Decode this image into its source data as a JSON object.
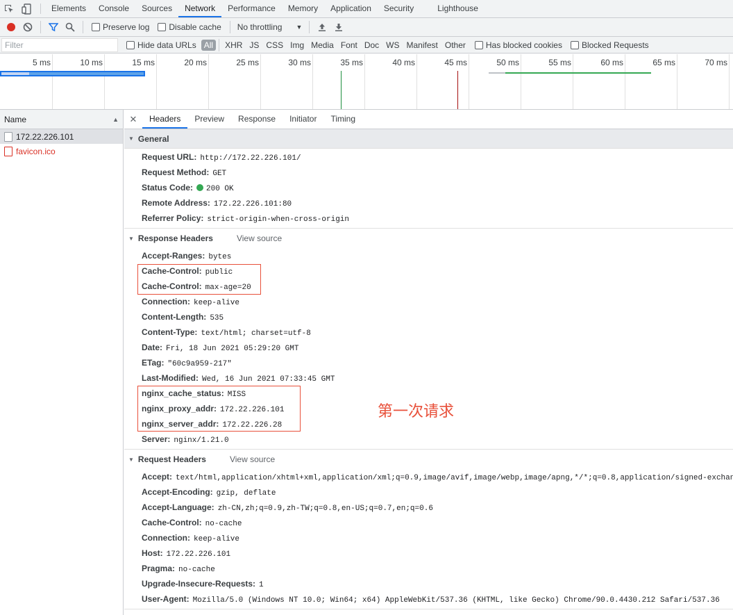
{
  "tabs": [
    {
      "label": "Elements"
    },
    {
      "label": "Console"
    },
    {
      "label": "Sources"
    },
    {
      "label": "Network"
    },
    {
      "label": "Performance"
    },
    {
      "label": "Memory"
    },
    {
      "label": "Application"
    },
    {
      "label": "Security"
    },
    {
      "label": "Lighthouse"
    }
  ],
  "toolbar": {
    "preserve_log": "Preserve log",
    "disable_cache": "Disable cache",
    "throttling": "No throttling"
  },
  "filterbar": {
    "filter_placeholder": "Filter",
    "hide_data_urls": "Hide data URLs",
    "types": [
      "All",
      "XHR",
      "JS",
      "CSS",
      "Img",
      "Media",
      "Font",
      "Doc",
      "WS",
      "Manifest",
      "Other"
    ],
    "has_blocked_cookies": "Has blocked cookies",
    "blocked_requests": "Blocked Requests"
  },
  "overview": {
    "ticks": [
      "5 ms",
      "10 ms",
      "15 ms",
      "20 ms",
      "25 ms",
      "30 ms",
      "35 ms",
      "40 ms",
      "45 ms",
      "50 ms",
      "55 ms",
      "60 ms",
      "65 ms",
      "70 ms"
    ]
  },
  "request_list": {
    "header": "Name",
    "items": [
      {
        "name": "172.22.226.101"
      },
      {
        "name": "favicon.ico"
      }
    ]
  },
  "detail_tabs": [
    "Headers",
    "Preview",
    "Response",
    "Initiator",
    "Timing"
  ],
  "general": {
    "title": "General",
    "rows": [
      {
        "k": "Request URL:",
        "v": "http://172.22.226.101/"
      },
      {
        "k": "Request Method:",
        "v": "GET"
      },
      {
        "k": "Status Code:",
        "v": "200 OK"
      },
      {
        "k": "Remote Address:",
        "v": "172.22.226.101:80"
      },
      {
        "k": "Referrer Policy:",
        "v": "strict-origin-when-cross-origin"
      }
    ]
  },
  "response_headers": {
    "title": "Response Headers",
    "view_source": "View source",
    "rows": [
      {
        "k": "Accept-Ranges:",
        "v": "bytes"
      },
      {
        "k": "Cache-Control:",
        "v": "public"
      },
      {
        "k": "Cache-Control:",
        "v": "max-age=20"
      },
      {
        "k": "Connection:",
        "v": "keep-alive"
      },
      {
        "k": "Content-Length:",
        "v": "535"
      },
      {
        "k": "Content-Type:",
        "v": "text/html; charset=utf-8"
      },
      {
        "k": "Date:",
        "v": "Fri, 18 Jun 2021 05:29:20 GMT"
      },
      {
        "k": "ETag:",
        "v": "\"60c9a959-217\""
      },
      {
        "k": "Last-Modified:",
        "v": "Wed, 16 Jun 2021 07:33:45 GMT"
      },
      {
        "k": "nginx_cache_status:",
        "v": "MISS"
      },
      {
        "k": "nginx_proxy_addr:",
        "v": "172.22.226.101"
      },
      {
        "k": "nginx_server_addr:",
        "v": "172.22.226.28"
      },
      {
        "k": "Server:",
        "v": "nginx/1.21.0"
      }
    ]
  },
  "request_headers": {
    "title": "Request Headers",
    "view_source": "View source",
    "rows": [
      {
        "k": "Accept:",
        "v": "text/html,application/xhtml+xml,application/xml;q=0.9,image/avif,image/webp,image/apng,*/*;q=0.8,application/signed-exchan"
      },
      {
        "k": "Accept-Encoding:",
        "v": "gzip, deflate"
      },
      {
        "k": "Accept-Language:",
        "v": "zh-CN,zh;q=0.9,zh-TW;q=0.8,en-US;q=0.7,en;q=0.6"
      },
      {
        "k": "Cache-Control:",
        "v": "no-cache"
      },
      {
        "k": "Connection:",
        "v": "keep-alive"
      },
      {
        "k": "Host:",
        "v": "172.22.226.101"
      },
      {
        "k": "Pragma:",
        "v": "no-cache"
      },
      {
        "k": "Upgrade-Insecure-Requests:",
        "v": "1"
      },
      {
        "k": "User-Agent:",
        "v": "Mozilla/5.0 (Windows NT 10.0; Win64; x64) AppleWebKit/537.36 (KHTML, like Gecko) Chrome/90.0.4430.212 Safari/537.36"
      }
    ]
  },
  "annotation": "第一次请求",
  "colors": {
    "accent": "#1a73e8",
    "record": "#d93025",
    "status_ok": "#34a853",
    "annotation": "#e8503a"
  }
}
